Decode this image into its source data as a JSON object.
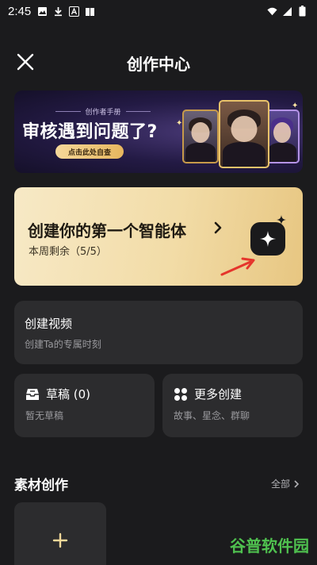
{
  "status_bar": {
    "time": "2:45",
    "left_icons": [
      "image-icon",
      "download-icon",
      "a-icon",
      "book-icon"
    ],
    "right_icons": [
      "wifi-icon",
      "signal-icon",
      "battery-icon"
    ]
  },
  "header": {
    "title": "创作中心"
  },
  "banner": {
    "subtitle": "创作者手册",
    "title": "审核遇到问题了?",
    "button_label": "点击此处自查"
  },
  "agent_card": {
    "title": "创建你的第一个智能体",
    "quota_text": "本周剩余（5/5）"
  },
  "video_card": {
    "title": "创建视频",
    "subtitle": "创建Ta的专属时刻"
  },
  "draft_card": {
    "title": "草稿 (0)",
    "subtitle": "暂无草稿"
  },
  "more_card": {
    "title": "更多创建",
    "subtitle": "故事、星念、群聊"
  },
  "materials": {
    "section_title": "素材创作",
    "all_label": "全部"
  },
  "watermark": "谷普软件园",
  "colors": {
    "background": "#1b1b1d",
    "card": "#2c2c2e",
    "agent_card_gold": "#f2dca7",
    "arrow_red": "#e5352c",
    "watermark_green": "#4fc14f"
  }
}
